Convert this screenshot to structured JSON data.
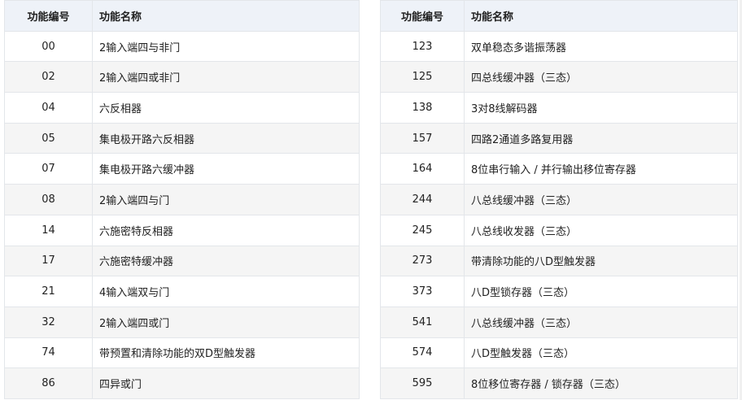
{
  "left_table": {
    "headers": {
      "code": "功能编号",
      "name": "功能名称"
    },
    "rows": [
      {
        "code": "00",
        "name": "2输入端四与非门"
      },
      {
        "code": "02",
        "name": "2输入端四或非门"
      },
      {
        "code": "04",
        "name": "六反相器"
      },
      {
        "code": "05",
        "name": "集电极开路六反相器"
      },
      {
        "code": "07",
        "name": "集电极开路六缓冲器"
      },
      {
        "code": "08",
        "name": "2输入端四与门"
      },
      {
        "code": "14",
        "name": "六施密特反相器"
      },
      {
        "code": "17",
        "name": "六施密特缓冲器"
      },
      {
        "code": "21",
        "name": "4输入端双与门"
      },
      {
        "code": "32",
        "name": "2输入端四或门"
      },
      {
        "code": "74",
        "name": "带预置和清除功能的双D型触发器"
      },
      {
        "code": "86",
        "name": "四异或门"
      }
    ]
  },
  "right_table": {
    "headers": {
      "code": "功能编号",
      "name": "功能名称"
    },
    "rows": [
      {
        "code": "123",
        "name": "双单稳态多谐振荡器"
      },
      {
        "code": "125",
        "name": "四总线缓冲器（三态）"
      },
      {
        "code": "138",
        "name": "3对8线解码器"
      },
      {
        "code": "157",
        "name": "四路2通道多路复用器"
      },
      {
        "code": "164",
        "name": "8位串行输入 / 并行输出移位寄存器"
      },
      {
        "code": "244",
        "name": "八总线缓冲器（三态）"
      },
      {
        "code": "245",
        "name": "八总线收发器（三态）"
      },
      {
        "code": "273",
        "name": "带清除功能的八D型触发器"
      },
      {
        "code": "373",
        "name": "八D型锁存器（三态）"
      },
      {
        "code": "541",
        "name": "八总线缓冲器（三态）"
      },
      {
        "code": "574",
        "name": "八D型触发器（三态）"
      },
      {
        "code": "595",
        "name": "8位移位寄存器 / 锁存器（三态）"
      }
    ]
  }
}
